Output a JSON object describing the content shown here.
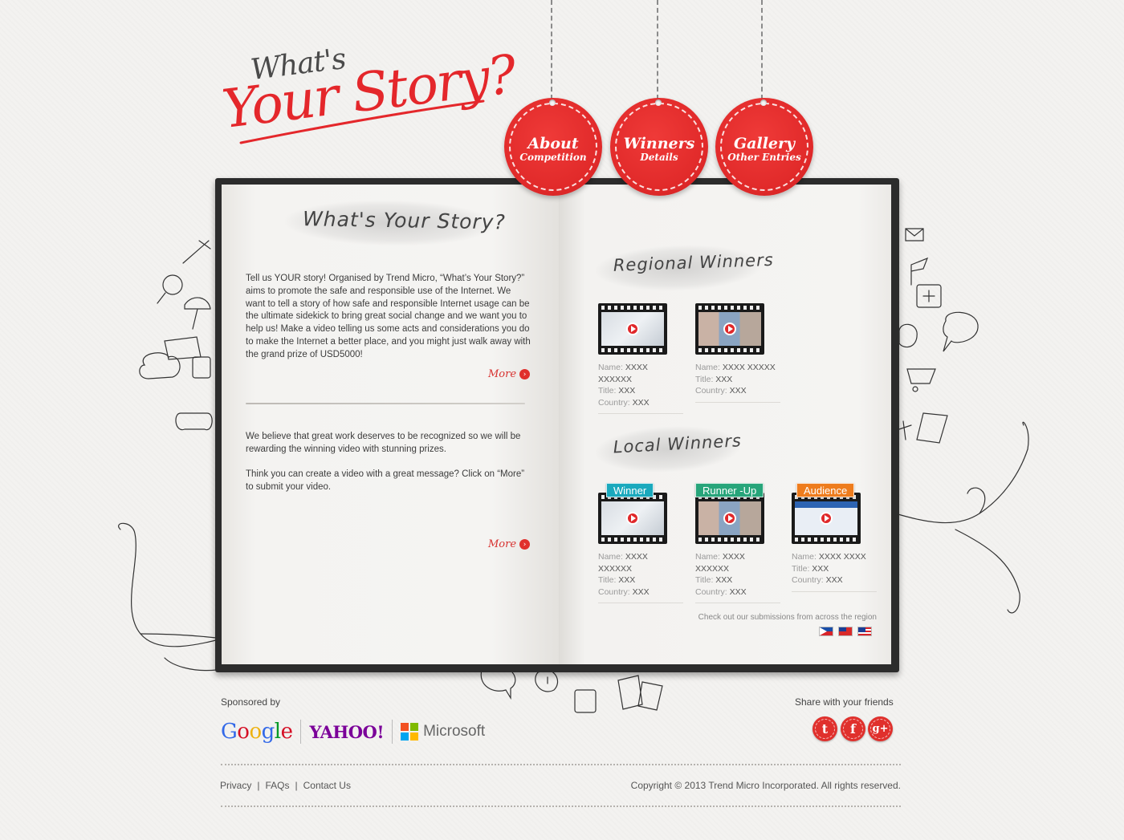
{
  "logo": {
    "line1": "What's",
    "line2": "Your Story?"
  },
  "nav": [
    {
      "title": "About",
      "subtitle": "Competition"
    },
    {
      "title": "Winners",
      "subtitle": "Details"
    },
    {
      "title": "Gallery",
      "subtitle": "Other Entries"
    }
  ],
  "left_page": {
    "title": "What's Your Story?",
    "intro": "Tell us YOUR story! Organised by Trend Micro, “What’s Your Story?” aims to promote the safe and responsible use of the Internet. We want to tell a story of how safe and responsible Internet usage can be the ultimate sidekick to bring great social change and we want you to help us! Make a video telling us some acts and considerations you do to make the Internet a better place, and you might just walk away with the grand prize of USD5000!",
    "more1": "More",
    "para2": "We believe that great work deserves to be recognized so we will be rewarding the winning video with stunning prizes.",
    "para3": "Think you can create a video with a great message? Click on “More” to submit your video.",
    "more2": "More"
  },
  "right_page": {
    "regional_title": "Regional Winners",
    "local_title": "Local Winners",
    "labels": {
      "name": "Name:",
      "title": "Title:",
      "country": "Country:"
    },
    "regional": [
      {
        "name": "XXXX XXXXXX",
        "title": "XXX",
        "country": "XXX"
      },
      {
        "name": "XXXX XXXXX",
        "title": "XXX",
        "country": "XXX"
      }
    ],
    "local": [
      {
        "badge": "Winner",
        "name": "XXXX XXXXXX",
        "title": "XXX",
        "country": "XXX"
      },
      {
        "badge": "Runner -Up",
        "name": "XXXX XXXXXX",
        "title": "XXX",
        "country": "XXX"
      },
      {
        "badge": "Audience",
        "name": "XXXX XXXX",
        "title": "XXX",
        "country": "XXX"
      }
    ],
    "region_note": "Check out our submissions from across the region"
  },
  "footer": {
    "sponsored_by": "Sponsored by",
    "sponsors": {
      "google": [
        "G",
        "o",
        "o",
        "g",
        "l",
        "e"
      ],
      "yahoo": "YAHOO!",
      "microsoft": "Microsoft"
    },
    "share": "Share with your friends",
    "social": [
      "twitter-icon",
      "facebook-icon",
      "google-plus-icon"
    ],
    "links": [
      "Privacy",
      "FAQs",
      "Contact Us"
    ],
    "copyright": "Copyright © 2013 Trend Micro Incorporated. All rights reserved."
  },
  "colors": {
    "accent": "#e12a2a",
    "teal": "#1aa9bd",
    "green": "#27a57a",
    "orange": "#ee7c1d"
  }
}
